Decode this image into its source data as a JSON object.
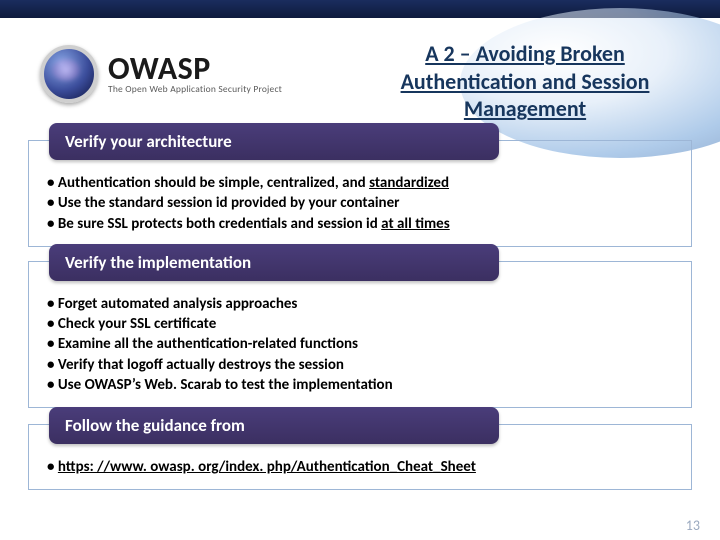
{
  "brand": "OWASP",
  "tagline": "The Open Web Application Security Project",
  "title": "A 2 – Avoiding Broken Authentication and Session Management",
  "sections": [
    {
      "heading": "Verify your architecture",
      "items": [
        {
          "pre": "• Authentication should be simple, centralized, and ",
          "u": "standardized",
          "post": ""
        },
        {
          "pre": "• Use the standard session id provided by your container",
          "u": "",
          "post": ""
        },
        {
          "pre": "• Be sure SSL protects both credentials and session id ",
          "u": "at all times",
          "post": ""
        }
      ]
    },
    {
      "heading": "Verify the implementation",
      "items": [
        {
          "pre": "• Forget automated analysis approaches",
          "u": "",
          "post": ""
        },
        {
          "pre": "• Check your SSL certificate",
          "u": "",
          "post": ""
        },
        {
          "pre": "• Examine all the authentication-related functions",
          "u": "",
          "post": ""
        },
        {
          "pre": "• Verify that logoff actually destroys the session",
          "u": "",
          "post": ""
        },
        {
          "pre": "• Use OWASP’s Web. Scarab to test the implementation",
          "u": "",
          "post": ""
        }
      ]
    },
    {
      "heading": "Follow the guidance from",
      "items": [
        {
          "pre": "• ",
          "u": "https: //www. owasp. org/index. php/Authentication_Cheat_Sheet",
          "post": "",
          "link": true
        }
      ]
    }
  ],
  "page_number": "13"
}
